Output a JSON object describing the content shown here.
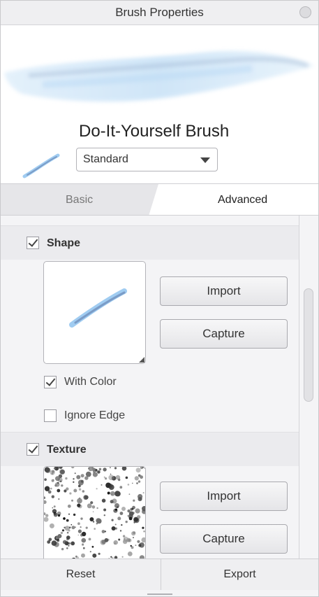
{
  "window": {
    "title": "Brush Properties"
  },
  "brush": {
    "name": "Do-It-Yourself Brush",
    "preset": "Standard"
  },
  "tabs": [
    {
      "label": "Basic",
      "active": false
    },
    {
      "label": "Advanced",
      "active": true
    }
  ],
  "shape": {
    "title": "Shape",
    "enabled": true,
    "import_label": "Import",
    "capture_label": "Capture",
    "with_color": {
      "label": "With Color",
      "checked": true
    },
    "ignore_edge": {
      "label": "Ignore Edge",
      "checked": false
    }
  },
  "texture": {
    "title": "Texture",
    "enabled": true,
    "import_label": "Import",
    "capture_label": "Capture"
  },
  "footer": {
    "reset_label": "Reset",
    "export_label": "Export"
  },
  "colors": {
    "accent_blue": "#8fc3ee",
    "panel_bg": "#f4f4f6",
    "header_bg": "#ebebee"
  }
}
